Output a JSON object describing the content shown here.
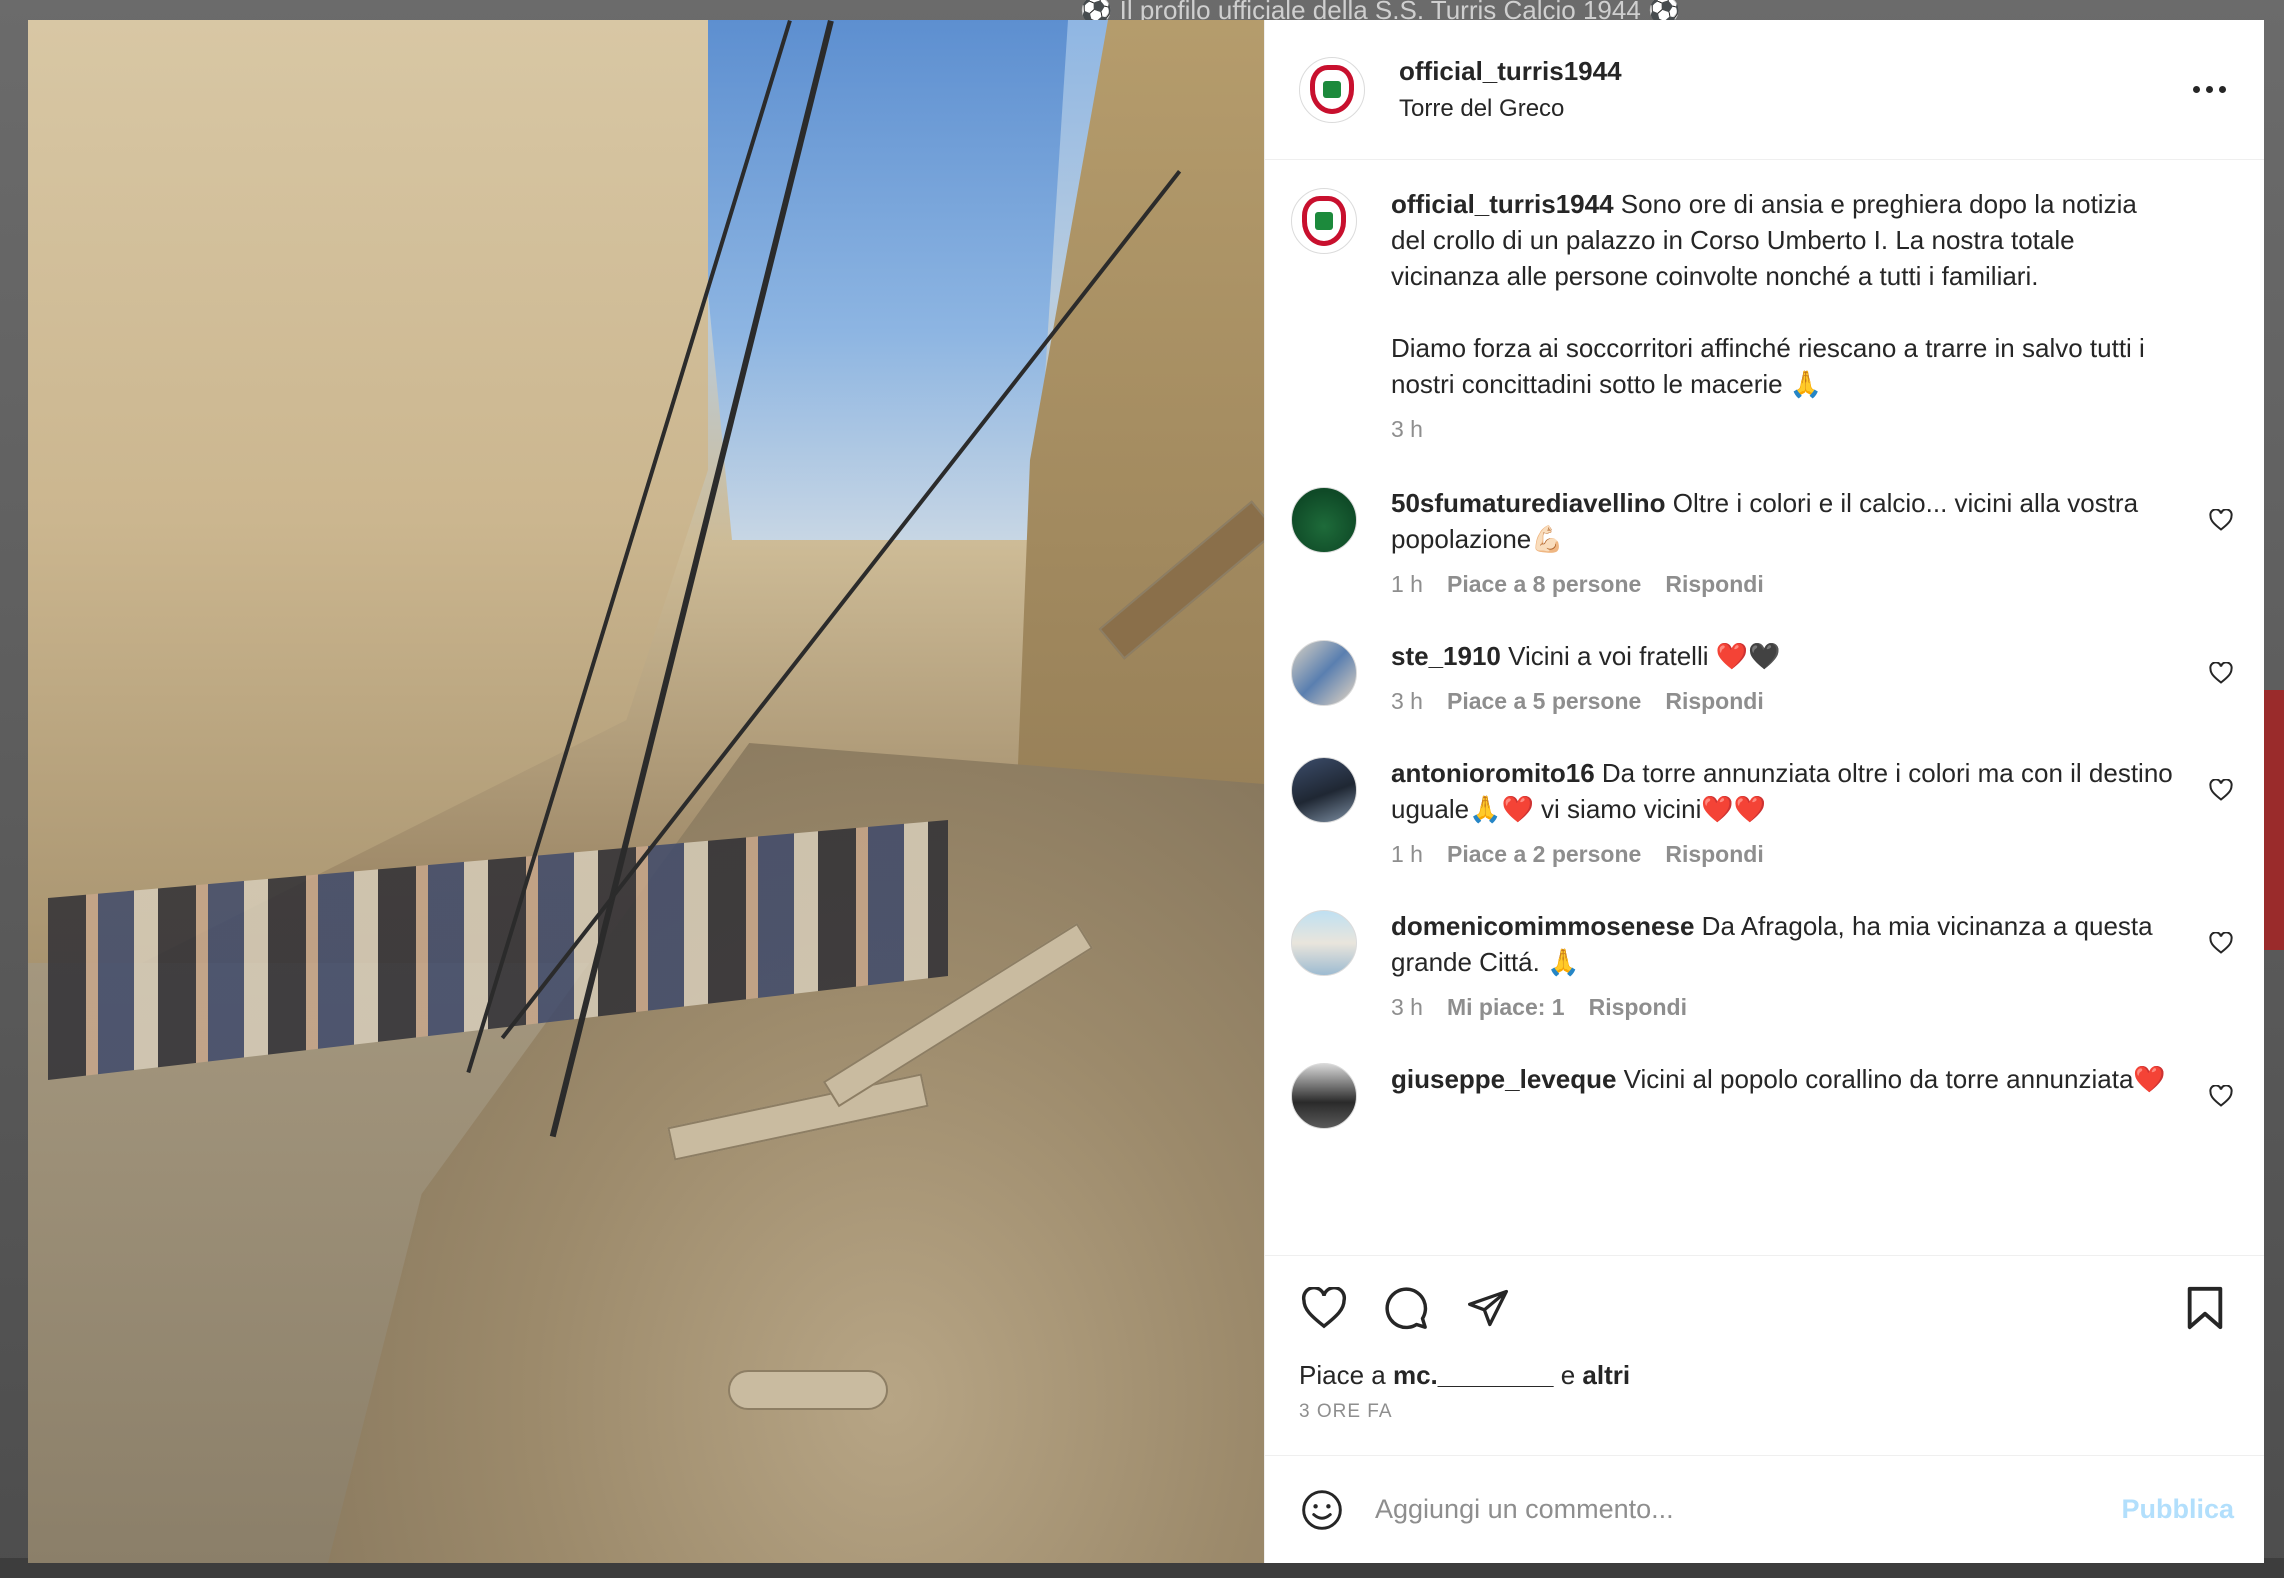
{
  "backdrop": {
    "profile_tagline": "⚽ Il profilo ufficiale della S.S. Turris Calcio 1944 ⚽"
  },
  "post": {
    "username": "official_turris1944",
    "location": "Torre del Greco",
    "more_icon": "more-horizontal-icon",
    "caption": {
      "username": "official_turris1944",
      "paragraph1": "Sono ore di ansia e preghiera dopo la notizia del crollo di un palazzo in Corso Umberto I. La nostra totale vicinanza alle persone coinvolte nonché a tutti i familiari.",
      "paragraph2": "Diamo forza ai soccorritori affinché riescano a trarre in salvo tutti i nostri concittadini sotto le macerie 🙏",
      "time": "3 h"
    },
    "comments": [
      {
        "username": "50sfumaturediavellino",
        "text": "Oltre i colori e il calcio... vicini alla vostra popolazione💪🏻",
        "time": "1 h",
        "likes": "Piace a 8 persone",
        "reply": "Rispondi"
      },
      {
        "username": "ste_1910",
        "text": "Vicini a voi fratelli ❤️🖤",
        "time": "3 h",
        "likes": "Piace a 5 persone",
        "reply": "Rispondi"
      },
      {
        "username": "antonioromito16",
        "text": "Da torre annunziata oltre i colori ma con il destino uguale🙏❤️ vi siamo vicini❤️❤️",
        "time": "1 h",
        "likes": "Piace a 2 persone",
        "reply": "Rispondi"
      },
      {
        "username": "domenicomimmosenese",
        "text": "Da Afragola, ha mia vicinanza a questa grande Cittá. 🙏",
        "time": "3 h",
        "likes": "Mi piace: 1",
        "reply": "Rispondi"
      },
      {
        "username": "giuseppe_leveque",
        "text": "Vicini al popolo corallino da torre annunziata❤️",
        "time": "",
        "likes": "",
        "reply": ""
      }
    ],
    "likes_prefix": "Piace a",
    "likes_user": "mc.________",
    "likes_conj": "e",
    "likes_others": "altri",
    "time_ago": "3 ORE FA",
    "comment_placeholder": "Aggiungi un commento...",
    "publish_label": "Pubblica"
  },
  "colors": {
    "accent_red": "#c8102e",
    "text": "#262626",
    "muted": "#8e8e8e",
    "publish_disabled": "#b2dffc",
    "heart_red": "#ed4956"
  }
}
